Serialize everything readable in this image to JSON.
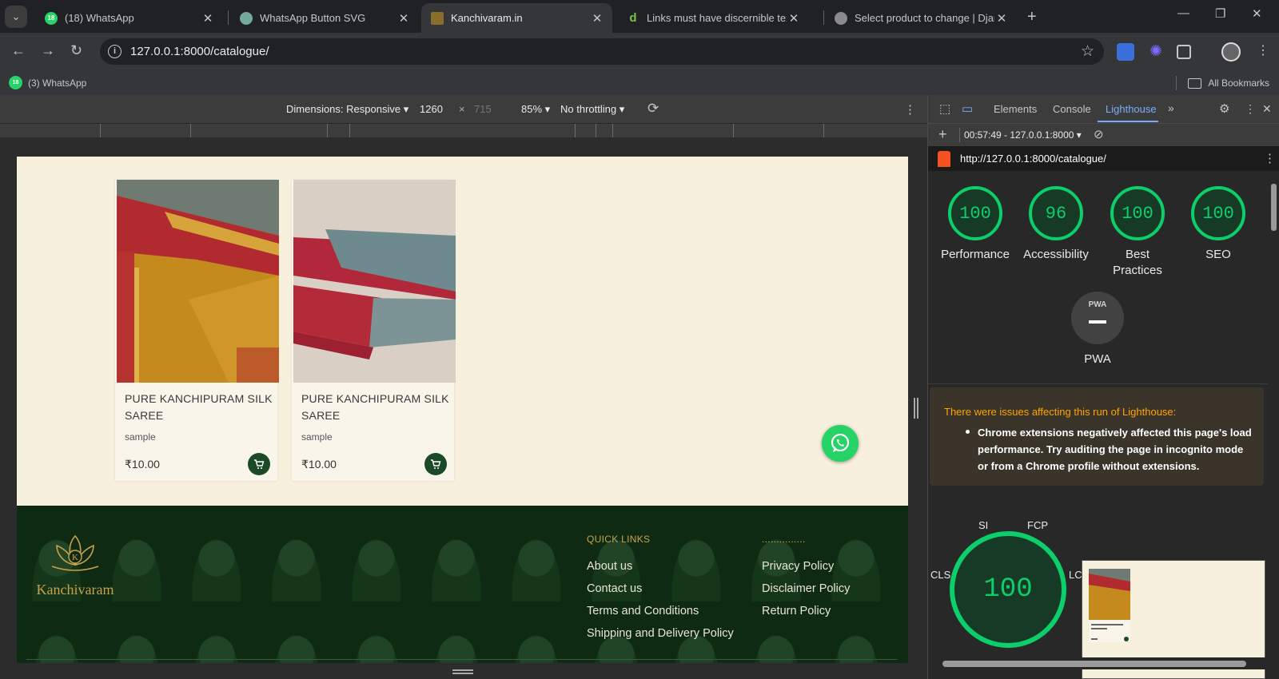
{
  "browser": {
    "tabs": [
      {
        "title": "(18) WhatsApp",
        "favicon": "whatsapp-icon",
        "active": false
      },
      {
        "title": "WhatsApp Button SVG",
        "favicon": "chatgpt-icon",
        "active": false
      },
      {
        "title": "Kanchivaram.in",
        "favicon": "kanchivaram-icon",
        "active": true
      },
      {
        "title": "Links must have discernible text",
        "favicon": "deque-icon",
        "active": false
      },
      {
        "title": "Select product to change | Djan",
        "favicon": "globe-icon",
        "active": false
      }
    ],
    "url": "127.0.0.1:8000/catalogue/",
    "bookmarks": {
      "whatsapp": "(3) WhatsApp",
      "all": "All Bookmarks"
    }
  },
  "device_toolbar": {
    "dimensions": "Dimensions: Responsive",
    "width": "1260",
    "separator": "×",
    "height": "715",
    "zoom": "85%",
    "throttling": "No throttling"
  },
  "page": {
    "products": [
      {
        "name": "PURE KANCHIPURAM SILK SAREE",
        "category": "sample",
        "price": "₹10.00"
      },
      {
        "name": "PURE KANCHIPURAM SILK SAREE",
        "category": "sample",
        "price": "₹10.00"
      }
    ],
    "footer": {
      "brand": "Kanchivaram",
      "logo_letter": "K",
      "quick_links_heading": "QUICK LINKS",
      "second_heading": "...............",
      "quick_links": [
        "About us",
        "Contact us",
        "Terms and Conditions",
        "Shipping and Delivery Policy"
      ],
      "policy_links": [
        "Privacy Policy",
        "Disclaimer Policy",
        "Return Policy"
      ]
    }
  },
  "devtools": {
    "tabs": [
      "Elements",
      "Console",
      "Lighthouse"
    ],
    "active_tab": "Lighthouse",
    "report_selector": "00:57:49 - 127.0.0.1:8000",
    "report_url": "http://127.0.0.1:8000/catalogue/",
    "scores": [
      {
        "label": "Performance",
        "value": "100"
      },
      {
        "label": "Accessibility",
        "value": "96"
      },
      {
        "label": "Best Practices",
        "value": "100"
      },
      {
        "label": "SEO",
        "value": "100"
      }
    ],
    "pwa": {
      "badge": "PWA",
      "label": "PWA"
    },
    "warning": {
      "heading": "There were issues affecting this run of Lighthouse:",
      "item": "Chrome extensions negatively affected this page's load performance. Try auditing the page in incognito mode or from a Chrome profile without extensions."
    },
    "performance_gauge": {
      "value": "100",
      "metrics": [
        "SI",
        "FCP",
        "CLS",
        "LCP"
      ]
    }
  },
  "colors": {
    "score_green": "#0cce6b",
    "footer_green": "#0f2a12",
    "page_bg": "#f6f0dc",
    "gold": "#c8a24b",
    "cart_green": "#1c4a28"
  }
}
